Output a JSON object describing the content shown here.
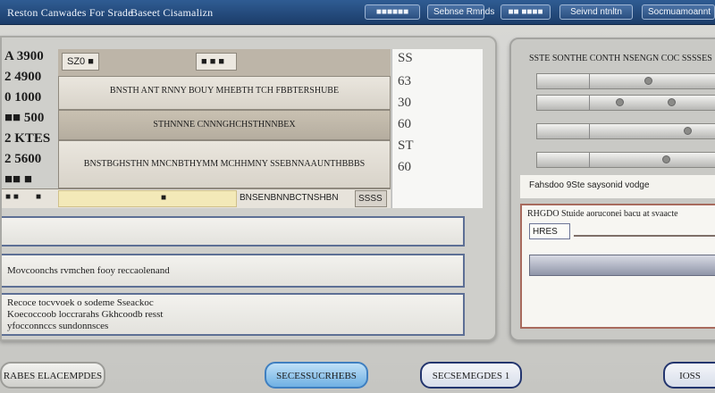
{
  "window": {
    "title": "Reston Canwades For Srade",
    "subtitle": "Baseet Cisamalizn"
  },
  "toolbar": {
    "buttons": [
      "■■■■■■",
      "Sebnse Rmnds",
      "■■ ■■■■",
      "Seivnd ntnltn",
      "Socmuamoannt"
    ]
  },
  "left_panel": {
    "row_labels": [
      "A 3900",
      "2 4900",
      "0 1000",
      "■■ 500",
      "2 KTES",
      "2 5600",
      "■■ ■"
    ],
    "grid_head": {
      "box1": "SZ0 ■",
      "box2": "■ ■ ■"
    },
    "grid_rows": [
      "BNSTH ANT RNNY BOUY MHEBTH TCH FBBTERSHUBE",
      "STHNNNE CNNNGHCHSTHNNBEX",
      "BNSTBGHSTHN MNCNBTHYMM MCHHMNY SSEBNNAAUNTHBBBS"
    ],
    "right_numbers": [
      "SS",
      "63",
      "30",
      "60",
      "ST",
      "60"
    ],
    "strip": {
      "cell1": "■ ■",
      "cell2": "■",
      "yellow": "■",
      "middle": "BNSENBNNBCTNSHBN",
      "last": "SSSS"
    },
    "field1": "",
    "field2": "Movcoonchs rvmchen fooy reccaolenand",
    "field3_lines": [
      "Recoce tocvvoek o sodeme Sseackoc",
      "Koecoccoob loccrarahs Gkhcoodb resst",
      "yfocconnccs sundonnsces"
    ]
  },
  "right_panel": {
    "header": "SSTE SONTHE CONTH NSENGN COC SSSSES",
    "sep_text": "Fahsdoo  9Ste  saysonid vodge",
    "box_line": "RHGDO Stuide aoruconei bacu at svaacte",
    "box_field": "HRES"
  },
  "bottom_buttons": [
    "RABES ELACEMPDES",
    "SECESSUCRHEBS",
    "SECSEMEGDES 1",
    "IOSS"
  ]
}
